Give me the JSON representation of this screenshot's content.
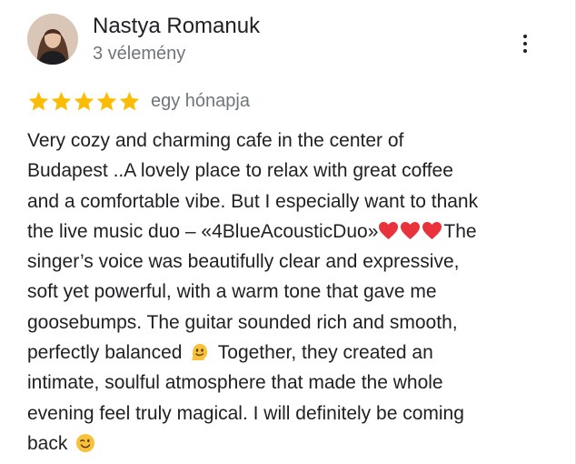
{
  "reviewer": {
    "name": "Nastya Romanuk",
    "review_count": "3 vélemény"
  },
  "review": {
    "rating": 5,
    "rating_max": 5,
    "date": "egy hónapja",
    "lines": [
      "Very cozy and charming cafe in the center of",
      "Budapest ..A lovely place to relax with great coffee",
      "and a comfortable vibe. But I especially want to thank",
      "the live music duo – «4BlueAcousticDuo»",
      "The",
      "singer’s voice was beautifully clear and expressive,",
      "soft yet powerful, with a warm tone that gave me",
      "goosebumps. The guitar sounded rich and smooth,",
      "perfectly balanced",
      "Together, they created an",
      "intimate, soulful atmosphere that made the whole",
      "evening feel truly magical. I will definitely be coming",
      "back"
    ]
  },
  "icons": {
    "avatar": "avatar",
    "menu": "more-vert-icon",
    "star": "star-icon",
    "heart": "red-heart-emoji",
    "melting_face": "melting-face-emoji",
    "wink": "winking-face-emoji"
  },
  "colors": {
    "star": "#fbbc04",
    "name": "#202124",
    "secondary": "#70757a",
    "heart": "#e8323c"
  }
}
